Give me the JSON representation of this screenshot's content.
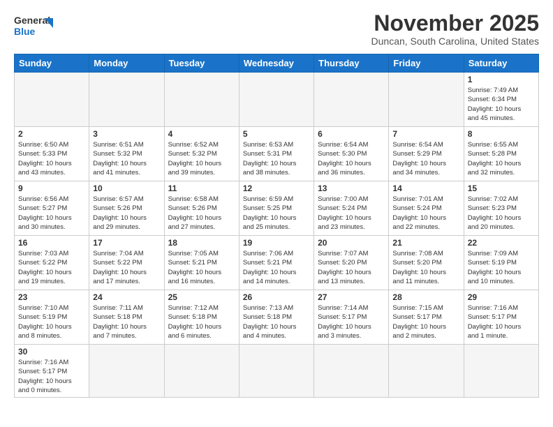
{
  "header": {
    "logo_general": "General",
    "logo_blue": "Blue",
    "month_title": "November 2025",
    "location": "Duncan, South Carolina, United States"
  },
  "days_of_week": [
    "Sunday",
    "Monday",
    "Tuesday",
    "Wednesday",
    "Thursday",
    "Friday",
    "Saturday"
  ],
  "weeks": [
    [
      {
        "day": "",
        "info": ""
      },
      {
        "day": "",
        "info": ""
      },
      {
        "day": "",
        "info": ""
      },
      {
        "day": "",
        "info": ""
      },
      {
        "day": "",
        "info": ""
      },
      {
        "day": "",
        "info": ""
      },
      {
        "day": "1",
        "info": "Sunrise: 7:49 AM\nSunset: 6:34 PM\nDaylight: 10 hours\nand 45 minutes."
      }
    ],
    [
      {
        "day": "2",
        "info": "Sunrise: 6:50 AM\nSunset: 5:33 PM\nDaylight: 10 hours\nand 43 minutes."
      },
      {
        "day": "3",
        "info": "Sunrise: 6:51 AM\nSunset: 5:32 PM\nDaylight: 10 hours\nand 41 minutes."
      },
      {
        "day": "4",
        "info": "Sunrise: 6:52 AM\nSunset: 5:32 PM\nDaylight: 10 hours\nand 39 minutes."
      },
      {
        "day": "5",
        "info": "Sunrise: 6:53 AM\nSunset: 5:31 PM\nDaylight: 10 hours\nand 38 minutes."
      },
      {
        "day": "6",
        "info": "Sunrise: 6:54 AM\nSunset: 5:30 PM\nDaylight: 10 hours\nand 36 minutes."
      },
      {
        "day": "7",
        "info": "Sunrise: 6:54 AM\nSunset: 5:29 PM\nDaylight: 10 hours\nand 34 minutes."
      },
      {
        "day": "8",
        "info": "Sunrise: 6:55 AM\nSunset: 5:28 PM\nDaylight: 10 hours\nand 32 minutes."
      }
    ],
    [
      {
        "day": "9",
        "info": "Sunrise: 6:56 AM\nSunset: 5:27 PM\nDaylight: 10 hours\nand 30 minutes."
      },
      {
        "day": "10",
        "info": "Sunrise: 6:57 AM\nSunset: 5:26 PM\nDaylight: 10 hours\nand 29 minutes."
      },
      {
        "day": "11",
        "info": "Sunrise: 6:58 AM\nSunset: 5:26 PM\nDaylight: 10 hours\nand 27 minutes."
      },
      {
        "day": "12",
        "info": "Sunrise: 6:59 AM\nSunset: 5:25 PM\nDaylight: 10 hours\nand 25 minutes."
      },
      {
        "day": "13",
        "info": "Sunrise: 7:00 AM\nSunset: 5:24 PM\nDaylight: 10 hours\nand 23 minutes."
      },
      {
        "day": "14",
        "info": "Sunrise: 7:01 AM\nSunset: 5:24 PM\nDaylight: 10 hours\nand 22 minutes."
      },
      {
        "day": "15",
        "info": "Sunrise: 7:02 AM\nSunset: 5:23 PM\nDaylight: 10 hours\nand 20 minutes."
      }
    ],
    [
      {
        "day": "16",
        "info": "Sunrise: 7:03 AM\nSunset: 5:22 PM\nDaylight: 10 hours\nand 19 minutes."
      },
      {
        "day": "17",
        "info": "Sunrise: 7:04 AM\nSunset: 5:22 PM\nDaylight: 10 hours\nand 17 minutes."
      },
      {
        "day": "18",
        "info": "Sunrise: 7:05 AM\nSunset: 5:21 PM\nDaylight: 10 hours\nand 16 minutes."
      },
      {
        "day": "19",
        "info": "Sunrise: 7:06 AM\nSunset: 5:21 PM\nDaylight: 10 hours\nand 14 minutes."
      },
      {
        "day": "20",
        "info": "Sunrise: 7:07 AM\nSunset: 5:20 PM\nDaylight: 10 hours\nand 13 minutes."
      },
      {
        "day": "21",
        "info": "Sunrise: 7:08 AM\nSunset: 5:20 PM\nDaylight: 10 hours\nand 11 minutes."
      },
      {
        "day": "22",
        "info": "Sunrise: 7:09 AM\nSunset: 5:19 PM\nDaylight: 10 hours\nand 10 minutes."
      }
    ],
    [
      {
        "day": "23",
        "info": "Sunrise: 7:10 AM\nSunset: 5:19 PM\nDaylight: 10 hours\nand 8 minutes."
      },
      {
        "day": "24",
        "info": "Sunrise: 7:11 AM\nSunset: 5:18 PM\nDaylight: 10 hours\nand 7 minutes."
      },
      {
        "day": "25",
        "info": "Sunrise: 7:12 AM\nSunset: 5:18 PM\nDaylight: 10 hours\nand 6 minutes."
      },
      {
        "day": "26",
        "info": "Sunrise: 7:13 AM\nSunset: 5:18 PM\nDaylight: 10 hours\nand 4 minutes."
      },
      {
        "day": "27",
        "info": "Sunrise: 7:14 AM\nSunset: 5:17 PM\nDaylight: 10 hours\nand 3 minutes."
      },
      {
        "day": "28",
        "info": "Sunrise: 7:15 AM\nSunset: 5:17 PM\nDaylight: 10 hours\nand 2 minutes."
      },
      {
        "day": "29",
        "info": "Sunrise: 7:16 AM\nSunset: 5:17 PM\nDaylight: 10 hours\nand 1 minute."
      }
    ],
    [
      {
        "day": "30",
        "info": "Sunrise: 7:16 AM\nSunset: 5:17 PM\nDaylight: 10 hours\nand 0 minutes."
      },
      {
        "day": "",
        "info": ""
      },
      {
        "day": "",
        "info": ""
      },
      {
        "day": "",
        "info": ""
      },
      {
        "day": "",
        "info": ""
      },
      {
        "day": "",
        "info": ""
      },
      {
        "day": "",
        "info": ""
      }
    ]
  ]
}
